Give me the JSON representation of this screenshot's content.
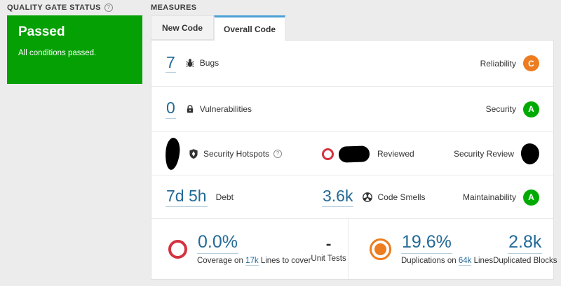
{
  "quality_gate": {
    "header": "QUALITY GATE STATUS",
    "status": "Passed",
    "description": "All conditions passed.",
    "status_color": "#04a004"
  },
  "measures": {
    "header": "MEASURES",
    "tabs": {
      "new_code": "New Code",
      "overall_code": "Overall Code"
    },
    "active_tab": "Overall Code",
    "accent_color": "#4b9fd5"
  },
  "rows": {
    "bugs": {
      "value": "7",
      "label": "Bugs",
      "rating_label": "Reliability",
      "rating": "C",
      "rating_color": "#ed7d20"
    },
    "vulnerabilities": {
      "value": "0",
      "label": "Vulnerabilities",
      "rating_label": "Security",
      "rating": "A",
      "rating_color": "#00aa00"
    },
    "security_hotspots": {
      "label": "Security Hotspots",
      "reviewed_label": "Reviewed",
      "rating_label": "Security Review"
    },
    "maintainability": {
      "debt_value": "7d 5h",
      "debt_label": "Debt",
      "code_smells_value": "3.6k",
      "code_smells_label": "Code Smells",
      "rating_label": "Maintainability",
      "rating": "A",
      "rating_color": "#00aa00"
    },
    "coverage": {
      "value": "0.0%",
      "label_before_link": "Coverage on",
      "link": "17k",
      "label_after_link": "Lines to cover",
      "unit_tests_value": "-",
      "unit_tests_label": "Unit Tests",
      "gauge_color": "#d4333f"
    },
    "duplications": {
      "value": "19.6%",
      "label_before_link": "Duplications on",
      "link": "64k",
      "label_after_link": "Lines",
      "blocks_value": "2.8k",
      "blocks_label": "Duplicated Blocks",
      "icon_color": "#ed7d20"
    }
  },
  "link_color": "#236a97"
}
